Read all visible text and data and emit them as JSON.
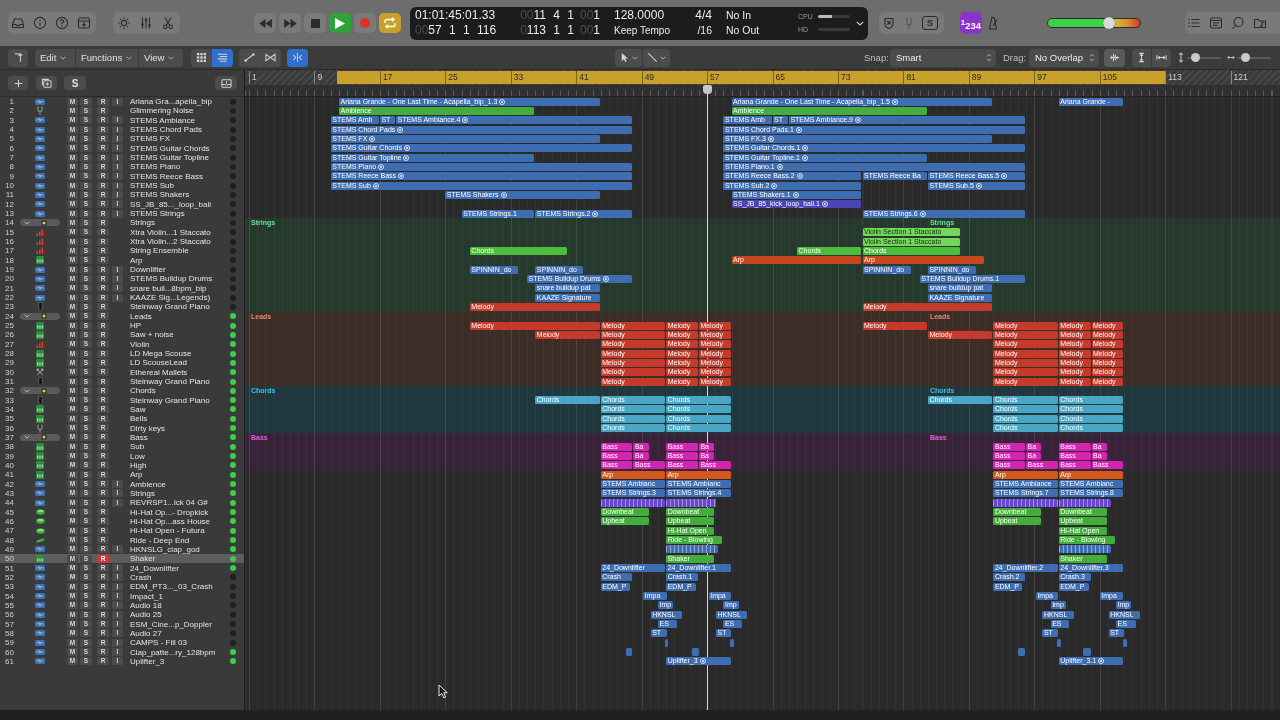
{
  "control_bar": {
    "transport": [
      {
        "kind": "rewind",
        "on": false
      },
      {
        "kind": "forward",
        "on": false
      },
      {
        "kind": "stop",
        "on": false
      },
      {
        "kind": "play",
        "on": true
      },
      {
        "kind": "record",
        "on": false
      },
      {
        "kind": "cycle",
        "on": true
      }
    ],
    "lcd": {
      "timecode": "01:01:45:01.33",
      "position": {
        "dim": "00",
        "value": "57 1 1 116"
      },
      "left_locator": {
        "dim": "00",
        "value": "11 4 1"
      },
      "right_locator": {
        "dim": "0",
        "value": "113 1 1"
      },
      "left_division": {
        "dim": "00",
        "value": "1"
      },
      "right_division": {
        "dim": "00",
        "value": "1"
      },
      "tempo": "128.0000",
      "tempo_mode": "Keep Tempo",
      "signature": "4/4",
      "division": "/16",
      "midi_in": "No In",
      "midi_out": "No Out",
      "meters": [
        {
          "label": "CPU",
          "level": 0.45
        },
        {
          "label": "HD"
        }
      ]
    },
    "mode_button": "S",
    "count_in": "$^{1}$234",
    "master_volume": {
      "level": 0.68
    }
  },
  "toolbar": {
    "menus": [
      "Edit",
      "Functions",
      "View"
    ],
    "toggles": [
      {
        "kind": "grid",
        "on": false
      },
      {
        "kind": "list",
        "on": true
      },
      {
        "kind": "automation",
        "on": false
      },
      {
        "kind": "flex",
        "on": false
      },
      {
        "kind": "catch",
        "on": true
      }
    ],
    "snap": {
      "label": "Snap:",
      "value": "Smart"
    },
    "drag": {
      "label": "Drag:",
      "value": "No Overlap"
    },
    "zoom": [
      {
        "kind": "vertical",
        "level": 0.15
      },
      {
        "kind": "horizontal",
        "level": 0.15
      }
    ]
  },
  "track_header": {
    "solo_button": "S"
  },
  "ruler": {
    "marks": [
      "1",
      "9",
      "17",
      "25",
      "33",
      "41",
      "49",
      "57",
      "65",
      "73",
      "81",
      "89",
      "97",
      "105",
      "113",
      "121"
    ]
  },
  "tracks": [
    {
      "no": "1",
      "kind": "audio",
      "name": "Ariana Gra...apella_bip",
      "m": "M",
      "s": "S",
      "r": "R",
      "i": "I",
      "armed": false,
      "monitor": false,
      "active": false,
      "selected": false,
      "color": "#3e6db1",
      "regions": [
        {
          "label": "Ariana Grande - One Last Time - Acapella_bip_1.3",
          "flex": true
        },
        {
          "label": "Ariana Grande - One Last Time - Acapella_bip_1.5",
          "flex": true
        },
        {
          "label": "Ariana Grande -",
          "flex": false
        }
      ]
    },
    {
      "no": "2",
      "kind": "fork",
      "name": "Glimmering Noise",
      "m": "M",
      "s": "S",
      "r": "R",
      "armed": false,
      "active": false,
      "selected": false,
      "color": "#43ad42",
      "regions": [
        {
          "label": "Ambience",
          "flex": false
        },
        {
          "label": "Ambience",
          "flex": false
        }
      ]
    },
    {
      "no": "3",
      "kind": "audio",
      "name": "STEMS Ambiance",
      "m": "M",
      "s": "S",
      "r": "R",
      "i": "I",
      "armed": false,
      "monitor": false,
      "active": false,
      "selected": false,
      "color": "#3e6db1",
      "regions": [
        {
          "label": "STEMS Amb",
          "flex": false
        },
        {
          "label": "ST",
          "flex": false
        },
        {
          "label": "STEMS Ambiance.4",
          "flex": true
        },
        {
          "label": "STEMS Amb",
          "flex": false
        },
        {
          "label": "ST",
          "flex": false
        },
        {
          "label": "STEMS Ambiance.9",
          "flex": true
        }
      ]
    },
    {
      "no": "4",
      "kind": "audio",
      "name": "STEMS Chord Pads",
      "m": "M",
      "s": "S",
      "r": "R",
      "i": "I",
      "armed": false,
      "monitor": false,
      "active": false,
      "selected": false,
      "color": "#3e6db1",
      "regions": [
        {
          "label": "STEMS Chord Pads",
          "flex": true
        },
        {
          "label": "STEMS Chord Pads.1",
          "flex": true
        }
      ]
    },
    {
      "no": "5",
      "kind": "audio",
      "name": "STEMS FX",
      "m": "M",
      "s": "S",
      "r": "R",
      "i": "I",
      "armed": false,
      "monitor": false,
      "active": false,
      "selected": false,
      "color": "#3e6db1",
      "regions": [
        {
          "label": "STEMS FX",
          "flex": true
        },
        {
          "label": "STEMS FX.3",
          "flex": true
        }
      ]
    },
    {
      "no": "6",
      "kind": "audio",
      "name": "STEMS Guitar Chords",
      "m": "M",
      "s": "S",
      "r": "R",
      "i": "I",
      "armed": false,
      "monitor": false,
      "active": false,
      "selected": false,
      "color": "#3e6db1",
      "regions": [
        {
          "label": "STEMS Guitar Chords",
          "flex": true
        },
        {
          "label": "STEMS Guitar Chords.1",
          "flex": true
        }
      ]
    },
    {
      "no": "7",
      "kind": "audio",
      "name": "STEMS Guitar Topline",
      "m": "M",
      "s": "S",
      "r": "R",
      "i": "I",
      "armed": false,
      "monitor": false,
      "active": false,
      "selected": false,
      "color": "#3e6db1",
      "regions": [
        {
          "label": "STEMS Guitar Topline",
          "flex": true
        },
        {
          "label": "STEMS Guitar Topline.1",
          "flex": true
        }
      ]
    },
    {
      "no": "8",
      "kind": "audio",
      "name": "STEMS Piano",
      "m": "M",
      "s": "S",
      "r": "R",
      "i": "I",
      "armed": false,
      "monitor": false,
      "active": false,
      "selected": false,
      "color": "#3e6db1",
      "regions": [
        {
          "label": "STEMS Piano",
          "flex": true
        },
        {
          "label": "STEMS Piano.1",
          "flex": true
        }
      ]
    },
    {
      "no": "9",
      "kind": "audio",
      "name": "STEMS Reece Bass",
      "m": "M",
      "s": "S",
      "r": "R",
      "i": "I",
      "armed": false,
      "monitor": false,
      "active": false,
      "selected": false,
      "color": "#3e6db1",
      "regions": [
        {
          "label": "STEMS Reece Bass",
          "flex": true
        },
        {
          "label": "STEMS Reece Bass.2",
          "flex": true
        },
        {
          "label": "STEMS Reece Ba",
          "flex": false
        },
        {
          "label": "STEMS Reece Bass.5",
          "flex": true
        }
      ]
    },
    {
      "no": "10",
      "kind": "audio",
      "name": "STEMS Sub",
      "m": "M",
      "s": "S",
      "r": "R",
      "i": "I",
      "armed": false,
      "monitor": false,
      "active": false,
      "selected": false,
      "color": "#3e6db1",
      "regions": [
        {
          "label": "STEMS Sub",
          "flex": true
        },
        {
          "label": "STEMS Sub.2",
          "flex": true
        },
        {
          "label": "STEMS Sub.5",
          "flex": true
        }
      ]
    },
    {
      "no": "11",
      "kind": "audio",
      "name": "STEMS Shakers",
      "m": "M",
      "s": "S",
      "r": "R",
      "i": "I",
      "armed": false,
      "monitor": false,
      "active": false,
      "selected": false,
      "color": "#3e6db1",
      "regions": [
        {
          "label": "STEMS Shakers",
          "flex": true
        },
        {
          "label": "STEMS Shakers.1",
          "flex": true
        }
      ]
    },
    {
      "no": "12",
      "kind": "audio",
      "name": "SS_JB_85..._loop_bali",
      "m": "M",
      "s": "S",
      "r": "R",
      "i": "I",
      "armed": false,
      "monitor": false,
      "active": false,
      "selected": false,
      "color": "#4b45b5",
      "regions": [
        {
          "label": "SS_JB_85_kick_loop_bali.1",
          "flex": true
        }
      ]
    },
    {
      "no": "13",
      "kind": "audio",
      "name": "STEMS Strings",
      "m": "M",
      "s": "S",
      "r": "R",
      "i": "I",
      "armed": false,
      "monitor": false,
      "active": false,
      "selected": false,
      "color": "#3e6db1",
      "regions": [
        {
          "label": "STEMS Strings.1",
          "flex": false
        },
        {
          "label": "STEMS Strings.2",
          "flex": true
        },
        {
          "label": "STEMS Strings.6",
          "flex": true
        }
      ]
    },
    {
      "no": "14",
      "kind": "folder",
      "name": "Strings",
      "m": "M",
      "s": "S",
      "r": "R",
      "armed": false,
      "active": false,
      "selected": false,
      "expanded": true,
      "color": "#26392d",
      "regions": [
        {
          "label": "Strings"
        },
        {
          "label": "Strings"
        }
      ],
      "children": [
        {
          "no": "15",
          "kind": "strings",
          "name": "Xtra Violin...1 Staccato",
          "m": "M",
          "s": "S",
          "r": "R",
          "armed": false,
          "active": false,
          "selected": false,
          "color": "#74d65a",
          "regions": [
            {
              "label": "Violin Section 1 Staccato",
              "flex": false
            }
          ]
        },
        {
          "no": "16",
          "kind": "strings",
          "name": "Xtra Violin...2 Staccato",
          "m": "M",
          "s": "S",
          "r": "R",
          "armed": false,
          "active": false,
          "selected": false,
          "color": "#74d65a",
          "regions": [
            {
              "label": "Violin Section 1 Staccato",
              "flex": false
            }
          ]
        },
        {
          "no": "17",
          "kind": "strings",
          "name": "String Ensemble",
          "m": "M",
          "s": "S",
          "r": "R",
          "armed": false,
          "active": false,
          "selected": false,
          "color": "#4cbe3c",
          "regions": [
            {
              "label": "Chords",
              "flex": false
            },
            {
              "label": "Chords",
              "flex": false
            },
            {
              "label": "Chords",
              "flex": false
            }
          ]
        },
        {
          "no": "18",
          "kind": "synth",
          "name": "Arp",
          "m": "M",
          "s": "S",
          "r": "R",
          "armed": false,
          "active": false,
          "selected": false,
          "color": "#c9471f",
          "regions": [
            {
              "label": "Arp",
              "flex": false
            },
            {
              "label": "Arp",
              "flex": false
            }
          ]
        },
        {
          "no": "19",
          "kind": "audio",
          "name": "Downlifter",
          "m": "M",
          "s": "S",
          "r": "R",
          "i": "I",
          "armed": false,
          "monitor": false,
          "active": false,
          "selected": false,
          "color": "#3e6db1",
          "regions": [
            {
              "label": "SPINNIN_do",
              "flex": false
            },
            {
              "label": "SPINNIN_do",
              "flex": false
            },
            {
              "label": "SPINNIN_do",
              "flex": false
            },
            {
              "label": "SPINNIN_do",
              "flex": false
            }
          ]
        },
        {
          "no": "20",
          "kind": "audio",
          "name": "STEMS Buildup Drums",
          "m": "M",
          "s": "S",
          "r": "R",
          "i": "I",
          "armed": false,
          "monitor": false,
          "active": false,
          "selected": false,
          "color": "#3e6db1",
          "regions": [
            {
              "label": "STEMS Buildup Drums",
              "flex": true
            },
            {
              "label": "STEMS Buildup Drums.1",
              "flex": false
            }
          ]
        },
        {
          "no": "21",
          "kind": "audio",
          "name": "snare buil...8bpm_bip",
          "m": "M",
          "s": "S",
          "r": "R",
          "i": "I",
          "armed": false,
          "monitor": false,
          "active": false,
          "selected": false,
          "color": "#3e6db1",
          "regions": [
            {
              "label": "snare buildup pat",
              "flex": false
            },
            {
              "label": "snare buildup pat",
              "flex": false
            }
          ]
        },
        {
          "no": "22",
          "kind": "audio",
          "name": "KAAZE Sig...Legends)",
          "m": "M",
          "s": "S",
          "r": "R",
          "i": "I",
          "armed": false,
          "monitor": false,
          "active": false,
          "selected": false,
          "color": "#3e6db1",
          "regions": [
            {
              "label": "KAAZE Signature",
              "flex": false
            },
            {
              "label": "KAAZE Signature",
              "flex": false
            }
          ]
        },
        {
          "no": "23",
          "kind": "piano",
          "name": "Steinway Grand Piano",
          "m": "M",
          "s": "S",
          "r": "R",
          "armed": false,
          "active": false,
          "selected": false,
          "color": "#c53a2b",
          "regions": [
            {
              "label": "Melody",
              "flex": false
            },
            {
              "label": "Melody",
              "flex": false
            }
          ]
        }
      ]
    },
    {
      "no": "24",
      "kind": "folder",
      "name": "Leads",
      "m": "M",
      "s": "S",
      "r": "R",
      "armed": false,
      "active": true,
      "selected": false,
      "expanded": true,
      "color": "#3d2d27",
      "regions": [
        {
          "label": "Leads"
        },
        {
          "label": "Leads"
        }
      ],
      "children": [
        {
          "no": "25",
          "kind": "synth",
          "name": "HP",
          "m": "M",
          "s": "S",
          "r": "R",
          "armed": false,
          "active": true,
          "selected": false,
          "color": "#c53a2b",
          "regions": [
            {
              "label": "Melody",
              "flex": false
            },
            {
              "label": "Melody",
              "flex": false
            },
            {
              "label": "Melody",
              "flex": false
            },
            {
              "label": "Melody",
              "flex": false
            },
            {
              "label": "Melody",
              "flex": false
            },
            {
              "label": "Melody",
              "flex": false
            },
            {
              "label": "Melody",
              "flex": false
            },
            {
              "label": "Melody",
              "flex": false
            }
          ]
        },
        {
          "no": "26",
          "kind": "synth",
          "name": "Saw + noise",
          "m": "M",
          "s": "S",
          "r": "R",
          "armed": false,
          "active": true,
          "selected": false,
          "color": "#c53a2b",
          "regions": [
            {
              "label": "Melody",
              "flex": false
            },
            {
              "label": "Melody",
              "flex": false
            },
            {
              "label": "Melody",
              "flex": false
            },
            {
              "label": "Melody",
              "flex": false
            },
            {
              "label": "Melody",
              "flex": false
            },
            {
              "label": "Melody",
              "flex": false
            },
            {
              "label": "Melody",
              "flex": false
            },
            {
              "label": "Melody",
              "flex": false
            }
          ]
        },
        {
          "no": "27",
          "kind": "strings",
          "name": "Violin",
          "m": "M",
          "s": "S",
          "r": "R",
          "armed": false,
          "active": true,
          "selected": false,
          "color": "#c53a2b",
          "regions": [
            {
              "label": "Melody",
              "flex": false
            },
            {
              "label": "Melody",
              "flex": false
            },
            {
              "label": "Melody",
              "flex": false
            },
            {
              "label": "Melody",
              "flex": false
            },
            {
              "label": "Melody",
              "flex": false
            },
            {
              "label": "Melody",
              "flex": false
            }
          ]
        },
        {
          "no": "28",
          "kind": "synth",
          "name": "LD Mega Scouse",
          "m": "M",
          "s": "S",
          "r": "R",
          "armed": false,
          "active": true,
          "selected": false,
          "color": "#c53a2b",
          "regions": [
            {
              "label": "Melody",
              "flex": false
            },
            {
              "label": "Melody",
              "flex": false
            },
            {
              "label": "Melody",
              "flex": false
            },
            {
              "label": "Melody",
              "flex": false
            },
            {
              "label": "Melody",
              "flex": false
            },
            {
              "label": "Melody",
              "flex": false
            }
          ]
        },
        {
          "no": "29",
          "kind": "synth",
          "name": "LD ScouseLead",
          "m": "M",
          "s": "S",
          "r": "R",
          "armed": false,
          "active": true,
          "selected": false,
          "color": "#c53a2b",
          "regions": [
            {
              "label": "Melody",
              "flex": false
            },
            {
              "label": "Melody",
              "flex": false
            },
            {
              "label": "Melody",
              "flex": false
            },
            {
              "label": "Melody",
              "flex": false
            },
            {
              "label": "Melody",
              "flex": false
            },
            {
              "label": "Melody",
              "flex": false
            }
          ]
        },
        {
          "no": "30",
          "kind": "mallets",
          "name": "Ethereal Mallets",
          "m": "M",
          "s": "S",
          "r": "R",
          "armed": false,
          "active": true,
          "selected": false,
          "color": "#c53a2b",
          "regions": [
            {
              "label": "Melody",
              "flex": false
            },
            {
              "label": "Melody",
              "flex": false
            },
            {
              "label": "Melody",
              "flex": false
            },
            {
              "label": "Melody",
              "flex": false
            },
            {
              "label": "Melody",
              "flex": false
            },
            {
              "label": "Melody",
              "flex": false
            }
          ]
        },
        {
          "no": "31",
          "kind": "piano",
          "name": "Steinway Grand Piano",
          "m": "M",
          "s": "S",
          "r": "R",
          "armed": false,
          "active": true,
          "selected": false,
          "color": "#c53a2b",
          "regions": [
            {
              "label": "Melody",
              "flex": false
            },
            {
              "label": "Melody",
              "flex": false
            },
            {
              "label": "Melody",
              "flex": false
            },
            {
              "label": "Melody",
              "flex": false
            },
            {
              "label": "Melody",
              "flex": false
            },
            {
              "label": "Melody",
              "flex": false
            }
          ]
        }
      ]
    },
    {
      "no": "32",
      "kind": "folder",
      "name": "Chords",
      "m": "M",
      "s": "S",
      "r": "R",
      "armed": false,
      "active": true,
      "selected": false,
      "expanded": true,
      "color": "#1f373d",
      "regions": [
        {
          "label": "Chords"
        },
        {
          "label": "Chords"
        }
      ],
      "children": [
        {
          "no": "33",
          "kind": "piano",
          "name": "Steinway Grand Piano",
          "m": "M",
          "s": "S",
          "r": "R",
          "armed": false,
          "active": true,
          "selected": false,
          "color": "#4aa6c5",
          "regions": [
            {
              "label": "Chords",
              "flex": false
            },
            {
              "label": "Chords",
              "flex": false
            },
            {
              "label": "Chords",
              "flex": false
            },
            {
              "label": "Chords",
              "flex": false
            },
            {
              "label": "Chords",
              "flex": false
            },
            {
              "label": "Chords",
              "flex": false
            }
          ]
        },
        {
          "no": "34",
          "kind": "synth",
          "name": "Saw",
          "m": "M",
          "s": "S",
          "r": "R",
          "armed": false,
          "active": true,
          "selected": false,
          "color": "#4aa6c5",
          "regions": [
            {
              "label": "Chords",
              "flex": false
            },
            {
              "label": "Chords",
              "flex": false
            },
            {
              "label": "Chords",
              "flex": false
            },
            {
              "label": "Chords",
              "flex": false
            }
          ]
        },
        {
          "no": "35",
          "kind": "synth",
          "name": "Bells",
          "m": "M",
          "s": "S",
          "r": "R",
          "armed": false,
          "active": true,
          "selected": false,
          "color": "#4aa6c5",
          "regions": [
            {
              "label": "Chords",
              "flex": false
            },
            {
              "label": "Chords",
              "flex": false
            },
            {
              "label": "Chords",
              "flex": false
            },
            {
              "label": "Chords",
              "flex": false
            }
          ]
        },
        {
          "no": "36",
          "kind": "fork",
          "name": "Dirty keys",
          "m": "M",
          "s": "S",
          "r": "R",
          "armed": false,
          "active": true,
          "selected": false,
          "color": "#4aa6c5",
          "regions": [
            {
              "label": "Chords",
              "flex": false
            },
            {
              "label": "Chords",
              "flex": false
            },
            {
              "label": "Chords",
              "flex": false
            },
            {
              "label": "Chords",
              "flex": false
            }
          ]
        }
      ]
    },
    {
      "no": "37",
      "kind": "folder",
      "name": "Bass",
      "m": "M",
      "s": "S",
      "r": "R",
      "armed": false,
      "active": true,
      "selected": false,
      "expanded": true,
      "color": "#392339",
      "regions": [
        {
          "label": "Bass"
        },
        {
          "label": "Bass"
        }
      ],
      "children": [
        {
          "no": "38",
          "kind": "synth",
          "name": "Sub",
          "m": "M",
          "s": "S",
          "r": "R",
          "armed": false,
          "active": true,
          "selected": false,
          "color": "#d424b2",
          "regions": [
            {
              "label": "Bass",
              "flex": false
            },
            {
              "label": "Ba",
              "flex": false
            },
            {
              "label": "Bass",
              "flex": false
            },
            {
              "label": "Ba",
              "flex": false
            },
            {
              "label": "Bass",
              "flex": false
            },
            {
              "label": "Ba",
              "flex": false
            },
            {
              "label": "Bass",
              "flex": false
            },
            {
              "label": "Ba",
              "flex": false
            }
          ]
        },
        {
          "no": "39",
          "kind": "synth",
          "name": "Low",
          "m": "M",
          "s": "S",
          "r": "R",
          "armed": false,
          "active": true,
          "selected": false,
          "color": "#d424b2",
          "regions": [
            {
              "label": "Bass",
              "flex": false
            },
            {
              "label": "Ba",
              "flex": false
            },
            {
              "label": "Bass",
              "flex": false
            },
            {
              "label": "Ba",
              "flex": false
            },
            {
              "label": "Bass",
              "flex": false
            },
            {
              "label": "Ba",
              "flex": false
            },
            {
              "label": "Bass",
              "flex": false
            },
            {
              "label": "Ba",
              "flex": false
            }
          ]
        },
        {
          "no": "40",
          "kind": "synth",
          "name": "High",
          "m": "M",
          "s": "S",
          "r": "R",
          "armed": false,
          "active": true,
          "selected": false,
          "color": "#d424b2",
          "regions": [
            {
              "label": "Bass",
              "flex": false
            },
            {
              "label": "Bass",
              "flex": false
            },
            {
              "label": "Bass",
              "flex": false
            },
            {
              "label": "Bass",
              "flex": false
            },
            {
              "label": "Bass",
              "flex": false
            },
            {
              "label": "Bass",
              "flex": false
            },
            {
              "label": "Bass",
              "flex": false
            },
            {
              "label": "Bass",
              "flex": false
            }
          ]
        }
      ]
    },
    {
      "no": "41",
      "kind": "synth",
      "name": "Arp",
      "m": "M",
      "s": "S",
      "r": "R",
      "armed": false,
      "active": true,
      "selected": false,
      "color": "#d4571e",
      "regions": [
        {
          "label": "Arp",
          "flex": false
        },
        {
          "label": "Arp",
          "flex": false
        },
        {
          "label": "Arp",
          "flex": false
        },
        {
          "label": "Arp",
          "flex": false
        }
      ]
    },
    {
      "no": "42",
      "kind": "audio",
      "name": "Ambience",
      "m": "M",
      "s": "S",
      "r": "R",
      "i": "I",
      "armed": false,
      "monitor": false,
      "active": true,
      "selected": false,
      "color": "#3e6db1",
      "regions": [
        {
          "label": "STEMS Ambianc",
          "flex": false
        },
        {
          "label": "STEMS Ambianc",
          "flex": false
        },
        {
          "label": "STEMS Ambiance",
          "flex": false
        },
        {
          "label": "STEMS Ambianc",
          "flex": false
        }
      ]
    },
    {
      "no": "43",
      "kind": "audio",
      "name": "Strings",
      "m": "M",
      "s": "S",
      "r": "R",
      "i": "I",
      "armed": false,
      "monitor": false,
      "active": true,
      "selected": false,
      "color": "#3e6db1",
      "regions": [
        {
          "label": "STEMS Strings.3",
          "flex": false
        },
        {
          "label": "STEMS Strings.4",
          "flex": false
        },
        {
          "label": "STEMS Strings.7",
          "flex": false
        },
        {
          "label": "STEMS Strings.8",
          "flex": false
        }
      ]
    },
    {
      "no": "44",
      "kind": "audio",
      "name": "REVRSP1...ick 04 G#",
      "m": "M",
      "s": "S",
      "r": "R",
      "i": "I",
      "armed": false,
      "monitor": false,
      "active": true,
      "selected": false,
      "color": "#6647d5",
      "regions": [
        {
          "flex": false
        },
        {
          "flex": false
        },
        {
          "flex": false
        },
        {
          "flex": false
        }
      ]
    },
    {
      "no": "45",
      "kind": "drum",
      "name": "Hi-Hat Op...- Dropkick",
      "m": "M",
      "s": "S",
      "r": "R",
      "armed": false,
      "active": true,
      "selected": false,
      "color": "#43ad3b",
      "regions": [
        {
          "label": "Downbeat",
          "flex": false
        },
        {
          "label": "Downbeat",
          "flex": false
        },
        {
          "label": "Downbeat",
          "flex": false
        },
        {
          "label": "Downbeat",
          "flex": false
        }
      ]
    },
    {
      "no": "46",
      "kind": "drum",
      "name": "Hi-Hat Op...ass House",
      "m": "M",
      "s": "S",
      "r": "R",
      "armed": false,
      "active": true,
      "selected": false,
      "color": "#43ad3b",
      "regions": [
        {
          "label": "Upbeat",
          "flex": false
        },
        {
          "label": "Upbeat",
          "flex": false
        },
        {
          "label": "Upbeat",
          "flex": false
        },
        {
          "label": "Upbeat",
          "flex": false
        }
      ]
    },
    {
      "no": "47",
      "kind": "drum",
      "name": "Hi-Hat Open - Futura",
      "m": "M",
      "s": "S",
      "r": "R",
      "armed": false,
      "active": true,
      "selected": false,
      "color": "#43ad3b",
      "regions": [
        {
          "label": "Hi-Hat Open",
          "flex": false
        },
        {
          "label": "Hi-Hat Open",
          "flex": false
        }
      ]
    },
    {
      "no": "48",
      "kind": "cymbal",
      "name": "Ride - Deep End",
      "m": "M",
      "s": "S",
      "r": "R",
      "armed": false,
      "active": true,
      "selected": false,
      "color": "#43ad3b",
      "regions": [
        {
          "label": "Ride - Blowing",
          "flex": false
        },
        {
          "label": "Ride - Blowing",
          "flex": false
        }
      ]
    },
    {
      "no": "49",
      "kind": "audio",
      "name": "HKNSLG_clap_god",
      "m": "M",
      "s": "S",
      "r": "R",
      "i": "I",
      "armed": false,
      "monitor": false,
      "active": true,
      "selected": false,
      "color": "#3e6db1",
      "regions": [
        {
          "flex": false
        },
        {
          "flex": false
        }
      ]
    },
    {
      "no": "50",
      "kind": "synth",
      "name": "Shaker",
      "m": "M",
      "s": "S",
      "r": "R",
      "armed": true,
      "active": true,
      "selected": true,
      "color": "#43ad3b",
      "regions": [
        {
          "label": "Shaker",
          "flex": false
        },
        {
          "label": "Shaker",
          "flex": false
        }
      ]
    },
    {
      "no": "51",
      "kind": "audio",
      "name": "24_Downlifter",
      "m": "M",
      "s": "S",
      "r": "R",
      "i": "I",
      "armed": false,
      "monitor": false,
      "active": true,
      "selected": false,
      "color": "#3e6db1",
      "regions": [
        {
          "label": "24_Downlifter",
          "flex": false
        },
        {
          "label": "24_Downlifter.1",
          "flex": false
        },
        {
          "label": "24_Downlifter.2",
          "flex": false
        },
        {
          "label": "24_Downlifter.3",
          "flex": false
        }
      ]
    },
    {
      "no": "52",
      "kind": "audio",
      "name": "Crash",
      "m": "M",
      "s": "S",
      "r": "R",
      "i": "I",
      "armed": false,
      "monitor": false,
      "active": false,
      "selected": false,
      "color": "#3e6db1",
      "regions": [
        {
          "label": "Crash",
          "flex": false
        },
        {
          "label": "Crash.1",
          "flex": false
        },
        {
          "label": "Crash.2",
          "flex": false
        },
        {
          "label": "Crash.3",
          "flex": false
        }
      ]
    },
    {
      "no": "53",
      "kind": "audio",
      "name": "EDM_PT3..._03_Crash",
      "m": "M",
      "s": "S",
      "r": "R",
      "i": "I",
      "armed": false,
      "monitor": false,
      "active": false,
      "selected": false,
      "color": "#3e6db1",
      "regions": [
        {
          "label": "EDM_P",
          "flex": false
        },
        {
          "label": "EDM_P",
          "flex": false
        },
        {
          "label": "EDM_P",
          "flex": false
        },
        {
          "label": "EDM_P",
          "flex": false
        }
      ]
    },
    {
      "no": "54",
      "kind": "audio",
      "name": "Impact_1",
      "m": "M",
      "s": "S",
      "r": "R",
      "i": "I",
      "armed": false,
      "monitor": false,
      "active": false,
      "selected": false,
      "color": "#3e6db1",
      "regions": [
        {
          "label": "Impa",
          "flex": false
        },
        {
          "label": "Impa",
          "flex": false
        },
        {
          "label": "Impa",
          "flex": false
        },
        {
          "label": "Impa",
          "flex": false
        }
      ]
    },
    {
      "no": "55",
      "kind": "audio",
      "name": "Audio 18",
      "m": "M",
      "s": "S",
      "r": "R",
      "i": "I",
      "armed": false,
      "monitor": true,
      "active": false,
      "selected": false,
      "color": "#3e6db1",
      "regions": [
        {
          "label": "Imp",
          "flex": false
        },
        {
          "label": "Imp",
          "flex": false
        },
        {
          "label": "Imp",
          "flex": false
        },
        {
          "label": "Imp",
          "flex": false
        }
      ]
    },
    {
      "no": "56",
      "kind": "audio",
      "name": "Audio 25",
      "m": "M",
      "s": "S",
      "r": "R",
      "i": "I",
      "armed": false,
      "monitor": false,
      "active": false,
      "selected": false,
      "color": "#3e6db1",
      "regions": [
        {
          "label": "HKNSL",
          "flex": false
        },
        {
          "label": "HKNSL",
          "flex": false
        },
        {
          "label": "HKNSL",
          "flex": false
        },
        {
          "label": "HKNSL",
          "flex": false
        }
      ]
    },
    {
      "no": "57",
      "kind": "audio",
      "name": "ESM_Cine...p_Doppler",
      "m": "M",
      "s": "S",
      "r": "R",
      "i": "I",
      "armed": false,
      "monitor": false,
      "active": false,
      "selected": false,
      "color": "#3e6db1",
      "regions": [
        {
          "label": "ES",
          "flex": false
        },
        {
          "label": "ES",
          "flex": false
        },
        {
          "label": "ES",
          "flex": false
        },
        {
          "label": "ES",
          "flex": false
        }
      ]
    },
    {
      "no": "58",
      "kind": "audio",
      "name": "Audio 27",
      "m": "M",
      "s": "S",
      "r": "R",
      "i": "I",
      "armed": false,
      "monitor": false,
      "active": false,
      "selected": false,
      "color": "#3e6db1",
      "regions": [
        {
          "label": "ST",
          "flex": false
        },
        {
          "label": "ST",
          "flex": false
        },
        {
          "label": "ST",
          "flex": false
        },
        {
          "label": "ST",
          "flex": false
        }
      ]
    },
    {
      "no": "59",
      "kind": "audio",
      "name": "CAMPS - Fill 03",
      "m": "M",
      "s": "S",
      "r": "R",
      "i": "I",
      "armed": false,
      "monitor": false,
      "active": false,
      "selected": false,
      "color": "#3e6db1",
      "regions": [
        {
          "flex": false
        },
        {
          "flex": false
        },
        {
          "flex": false
        },
        {
          "flex": false
        }
      ]
    },
    {
      "no": "60",
      "kind": "audio",
      "name": "Clap_patte...ry_128bpm",
      "m": "M",
      "s": "S",
      "r": "R",
      "i": "I",
      "armed": false,
      "monitor": false,
      "active": true,
      "selected": false,
      "color": "#3e6db1",
      "regions": [
        {
          "flex": false
        },
        {
          "flex": false
        },
        {
          "flex": false
        },
        {
          "flex": false
        }
      ]
    },
    {
      "no": "61",
      "kind": "audio",
      "name": "Uplifter_3",
      "m": "M",
      "s": "S",
      "r": "R",
      "i": "I",
      "armed": false,
      "monitor": false,
      "active": true,
      "selected": false,
      "color": "#3e6db1",
      "regions": [
        {
          "label": "Uplifter_3",
          "flex": true
        },
        {
          "label": "Uplifter_3.1",
          "flex": true
        }
      ]
    }
  ]
}
